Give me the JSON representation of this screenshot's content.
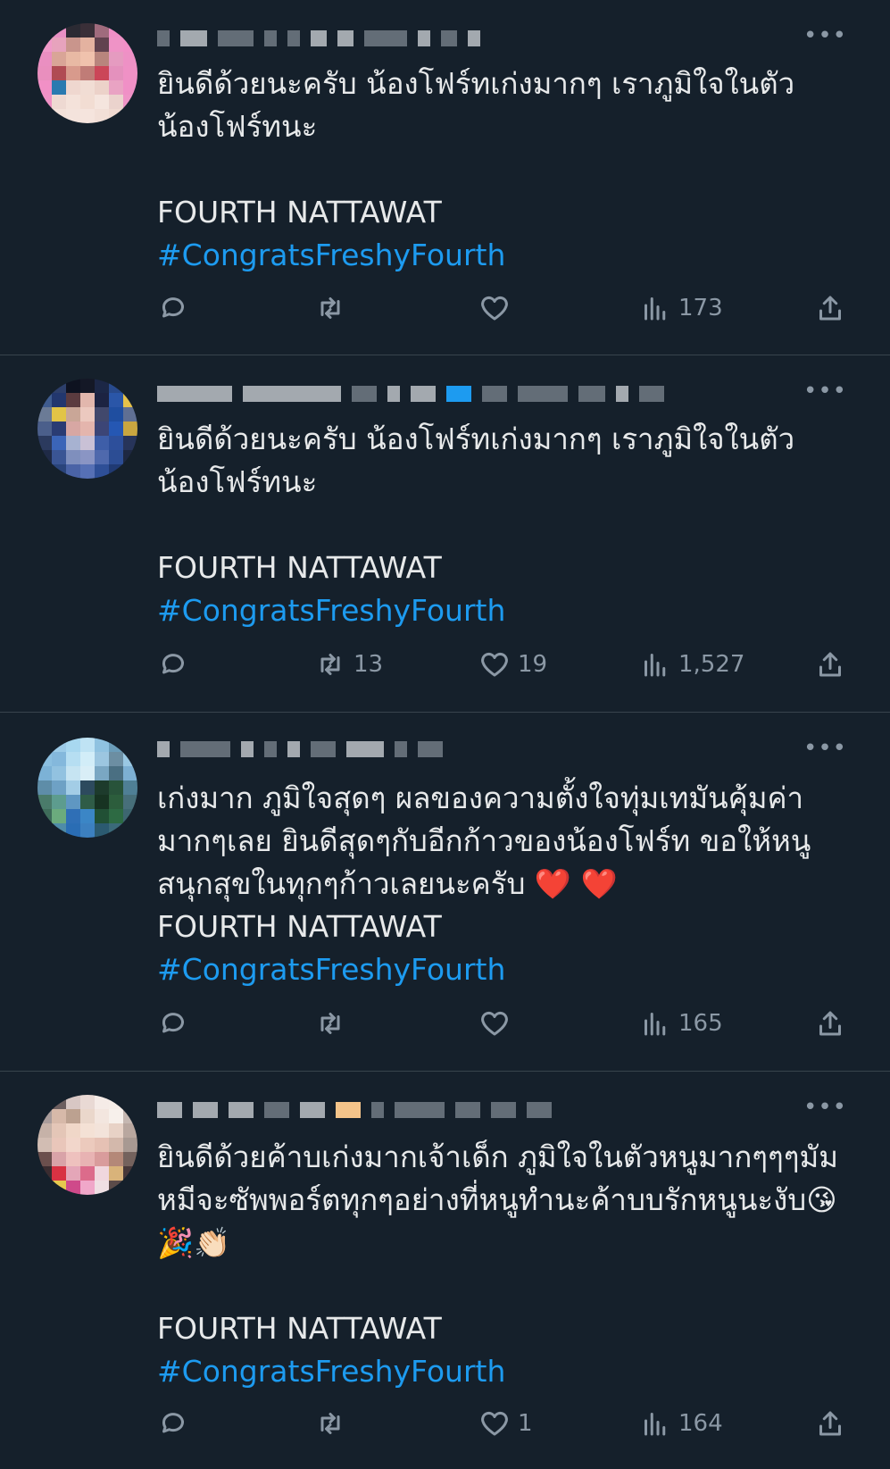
{
  "tweets": [
    {
      "text": "ยินดีด้วยนะครับ น้องโฟร์ทเก่งมากๆ เราภูมิใจในตัวน้องโฟร์ทนะ\n\nFOURTH NATTAWAT",
      "hashtag": "#CongratsFreshyFourth",
      "replies": "",
      "retweets": "",
      "likes": "",
      "views": "173"
    },
    {
      "text": "ยินดีด้วยนะครับ น้องโฟร์ทเก่งมากๆ เราภูมิใจในตัวน้องโฟร์ทนะ\n\nFOURTH NATTAWAT",
      "hashtag": "#CongratsFreshyFourth",
      "replies": "",
      "retweets": "13",
      "likes": "19",
      "views": "1,527"
    },
    {
      "text": "เก่งมาก ภูมิใจสุดๆ ผลของความตั้งใจทุ่มเทมันคุ้มค่ามากๆเลย ยินดีสุดๆกับอีกก้าวของน้องโฟร์ท ขอให้หนูสนุกสุขในทุกๆก้าวเลยนะครับ ❤️ ❤️\nFOURTH NATTAWAT",
      "hashtag": "#CongratsFreshyFourth",
      "replies": "",
      "retweets": "",
      "likes": "",
      "views": "165"
    },
    {
      "text": "ยินดีด้วยค้าบเก่งมากเจ้าเด็ก ภูมิใจในตัวหนูมากๆๆๆมัมหมีจะซัพพอร์ตทุกๆอย่างที่หนูทำนะค้าบบรักหนูนะงับ😘🎉👏🏻\n\nFOURTH NATTAWAT",
      "hashtag": "#CongratsFreshyFourth",
      "replies": "",
      "retweets": "",
      "likes": "1",
      "views": "164"
    }
  ],
  "more_glyph": "•••"
}
